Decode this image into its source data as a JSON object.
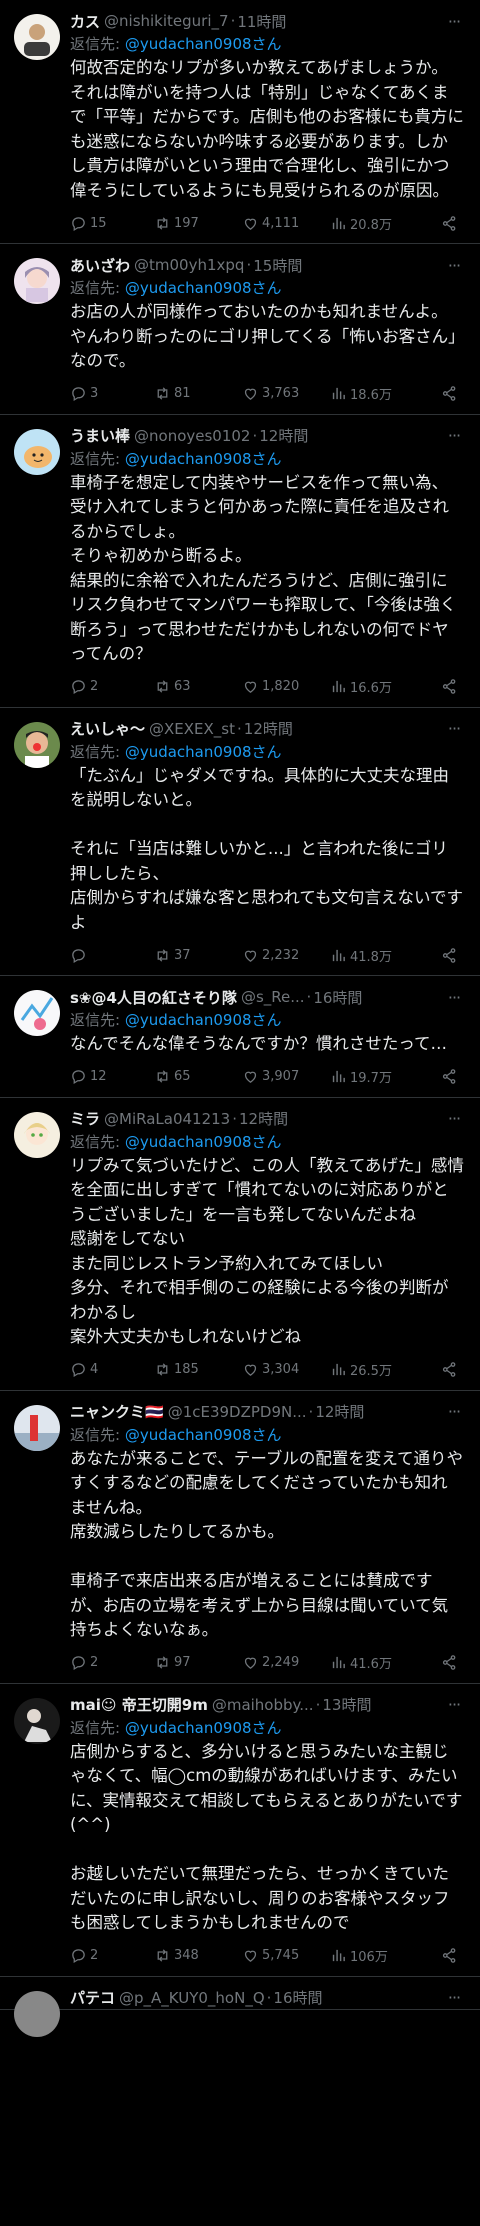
{
  "reply_prefix": "返信先: ",
  "tweets": [
    {
      "name": "カス",
      "handle": "@nishikiteguri_7",
      "time": "11時間",
      "mention": "@yudachan0908さん",
      "body": "何故否定的なリプが多いか教えてあげましょうか。それは障がいを持つ人は「特別」じゃなくてあくまで「平等」だからです。店側も他のお客様にも貴方にも迷惑にならないか吟味する必要があります。しかし貴方は障がいという理由で合理化し、強引にかつ偉そうにしているようにも見受けられるのが原因。",
      "stats": {
        "replies": "15",
        "retweets": "197",
        "likes": "4,111",
        "views": "20.8万"
      }
    },
    {
      "name": "あいざわ",
      "handle": "@tm00yh1xpq",
      "time": "15時間",
      "mention": "@yudachan0908さん",
      "body": "お店の人が同様作っておいたのかも知れませんよ。やんわり断ったのにゴリ押してくる「怖いお客さん」なので。",
      "stats": {
        "replies": "3",
        "retweets": "81",
        "likes": "3,763",
        "views": "18.6万"
      }
    },
    {
      "name": "うまい棒",
      "handle": "@nonoyes0102",
      "time": "12時間",
      "mention": "@yudachan0908さん",
      "body": "車椅子を想定して内装やサービスを作って無い為、受け入れてしまうと何かあった際に責任を追及されるからでしょ。\nそりゃ初めから断るよ。\n結果的に余裕で入れたんだろうけど、店側に強引にリスク負わせてマンパワーも搾取して、「今後は強く断ろう」って思わせただけかもしれないの何でドヤってんの？",
      "stats": {
        "replies": "2",
        "retweets": "63",
        "likes": "1,820",
        "views": "16.6万"
      }
    },
    {
      "name": "えいしゃ〜",
      "handle": "@XEXEX_st",
      "time": "12時間",
      "mention": "@yudachan0908さん",
      "body": "「たぶん」じゃダメですね。具体的に大丈夫な理由を説明しないと。\n\nそれに「当店は難しいかと...」と言われた後にゴリ押ししたら、\n店側からすれば嫌な客と思われても文句言えないですよ",
      "stats": {
        "replies": "",
        "retweets": "37",
        "likes": "2,232",
        "views": "41.8万"
      }
    },
    {
      "name": "s❀@4人目の紅さそり隊",
      "handle": "@s_Re...",
      "time": "16時間",
      "mention": "@yudachan0908さん",
      "body": "なんでそんな偉そうなんですか？慣れさせたって…",
      "stats": {
        "replies": "12",
        "retweets": "65",
        "likes": "3,907",
        "views": "19.7万"
      }
    },
    {
      "name": "ミラ",
      "handle": "@MiRaLa041213",
      "time": "12時間",
      "mention": "@yudachan0908さん",
      "body": "リプみて気づいたけど、この人「教えてあげた」感情を全面に出しすぎて「慣れてないのに対応ありがとうございました」を一言も発してないんだよね\n感謝をしてない\nまた同じレストラン予約入れてみてほしい\n多分、それで相手側のこの経験による今後の判断がわかるし\n案外大丈夫かもしれないけどね",
      "stats": {
        "replies": "4",
        "retweets": "185",
        "likes": "3,304",
        "views": "26.5万"
      }
    },
    {
      "name": "ニャンクミ🇹🇭",
      "handle": "@1cE39DZPD9N...",
      "time": "12時間",
      "mention": "@yudachan0908さん",
      "body": "あなたが来ることで、テーブルの配置を変えて通りやすくするなどの配慮をしてくださっていたかも知れませんね。\n席数減らしたりしてるかも。\n\n車椅子で来店出来る店が増えることには賛成ですが、お店の立場を考えず上から目線は聞いていて気持ちよくないなぁ。",
      "stats": {
        "replies": "2",
        "retweets": "97",
        "likes": "2,249",
        "views": "41.6万"
      }
    },
    {
      "name": "mai☺ 帝王切開9m",
      "handle": "@maihobby...",
      "time": "13時間",
      "mention": "@yudachan0908さん",
      "body": "店側からすると、多分いけると思うみたいな主観じゃなくて、幅◯cmの動線があればいけます、みたいに、実情報交えて相談してもらえるとありがたいです(^^)\n\nお越しいただいて無理だったら、せっかくきていただいたのに申し訳ないし、周りのお客様やスタッフも困惑してしまうかもしれませんので",
      "stats": {
        "replies": "2",
        "retweets": "348",
        "likes": "5,745",
        "views": "106万"
      }
    },
    {
      "name": "パテコ",
      "handle": "@p_A_KUY0_hoN_Q",
      "time": "16時間",
      "mention": "",
      "body": "",
      "stats": {
        "replies": "",
        "retweets": "",
        "likes": "",
        "views": ""
      }
    }
  ]
}
